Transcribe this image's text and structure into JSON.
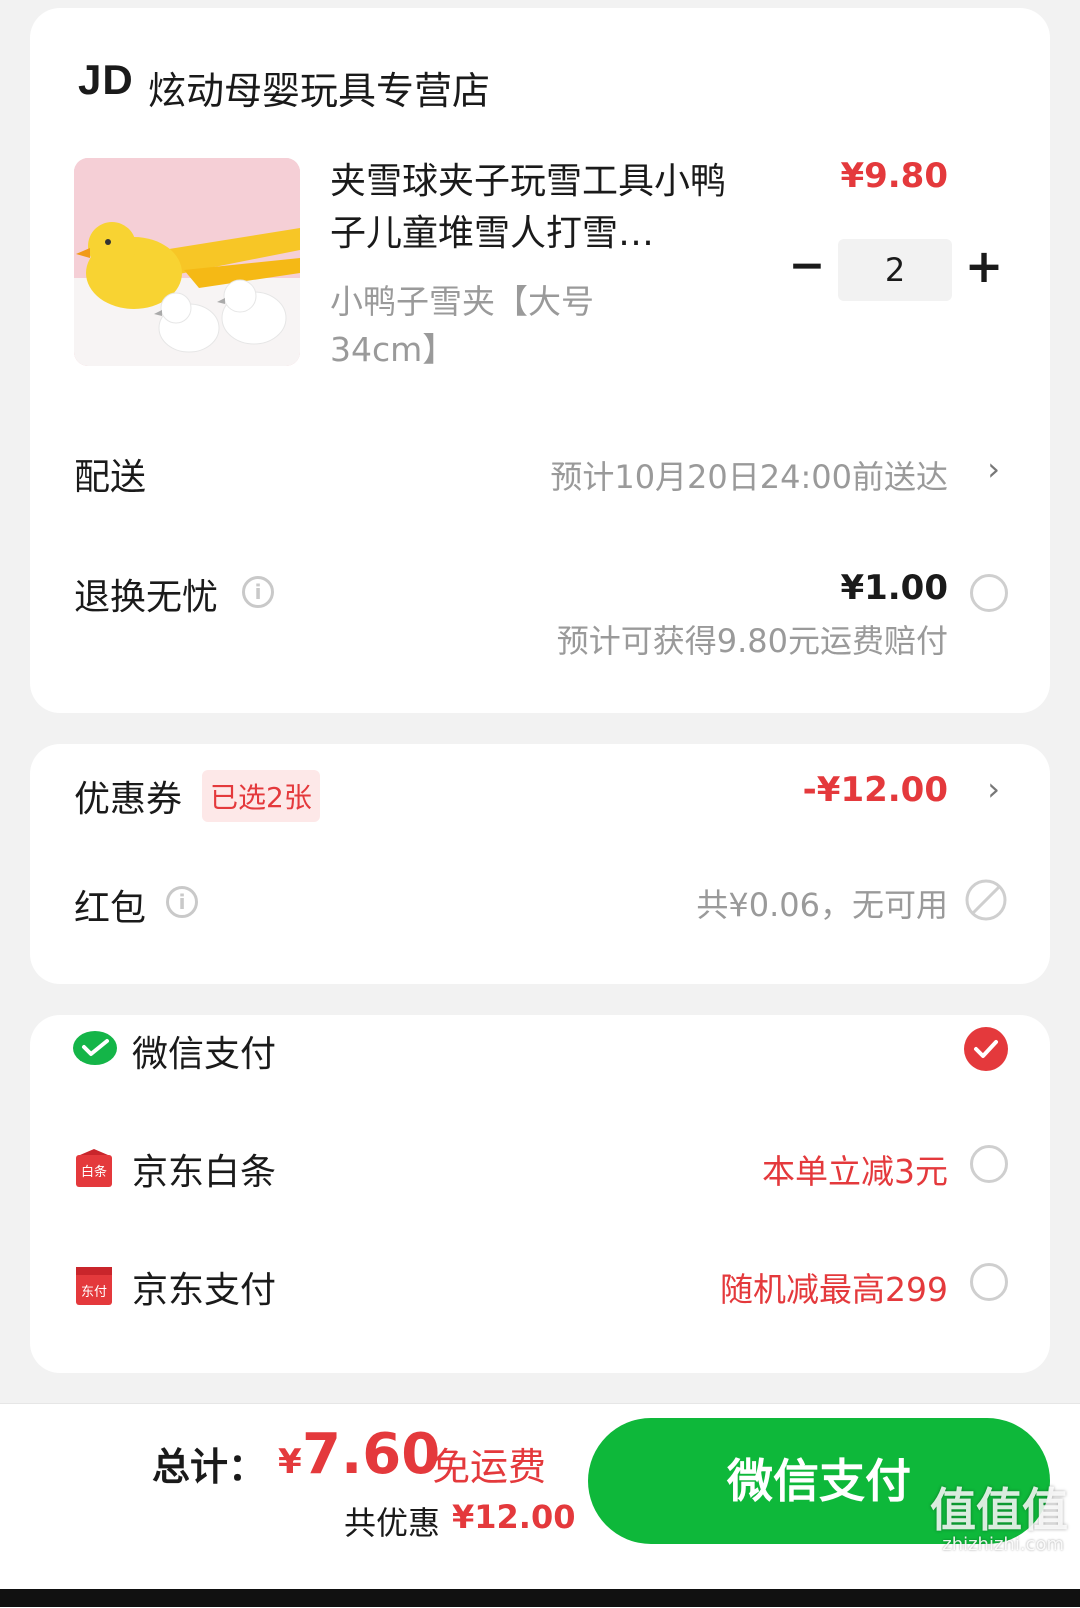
{
  "store": {
    "logo": "JD",
    "name": "炫动母婴玩具专营店"
  },
  "product": {
    "title": "夹雪球夹子玩雪工具小鸭子儿童堆雪人打雪…",
    "spec": "小鸭子雪夹【大号34cm】",
    "price": "¥9.80",
    "quantity": "2",
    "minus": "−",
    "plus": "+"
  },
  "delivery": {
    "label": "配送",
    "value": "预计10月20日24:00前送达"
  },
  "return_insurance": {
    "label": "退换无忧",
    "price": "¥1.00",
    "note": "预计可获得9.80元运费赔付"
  },
  "coupon": {
    "label": "优惠券",
    "badge": "已选2张",
    "value": "-¥12.00"
  },
  "red_packet": {
    "label": "红包",
    "value": "共¥0.06，无可用"
  },
  "payment_methods": [
    {
      "label": "微信支付",
      "promo": "",
      "selected": true,
      "icon": "wechat-pay-icon"
    },
    {
      "label": "京东白条",
      "promo": "本单立减3元",
      "selected": false,
      "icon": "jd-baitiao-icon"
    },
    {
      "label": "京东支付",
      "promo": "随机减最高299",
      "selected": false,
      "icon": "jd-pay-icon"
    }
  ],
  "footer": {
    "total_label": "总计：",
    "currency": "¥",
    "total": "7.60",
    "shipping": "免运费",
    "discount_label": "共优惠",
    "discount": "¥12.00",
    "pay_button": "微信支付"
  },
  "watermark": {
    "text": "值值值",
    "url": "zhizhizhi.com"
  },
  "colors": {
    "accent_red": "#e4393c",
    "wechat_green": "#0eb83a",
    "background": "#f2f2f2"
  }
}
